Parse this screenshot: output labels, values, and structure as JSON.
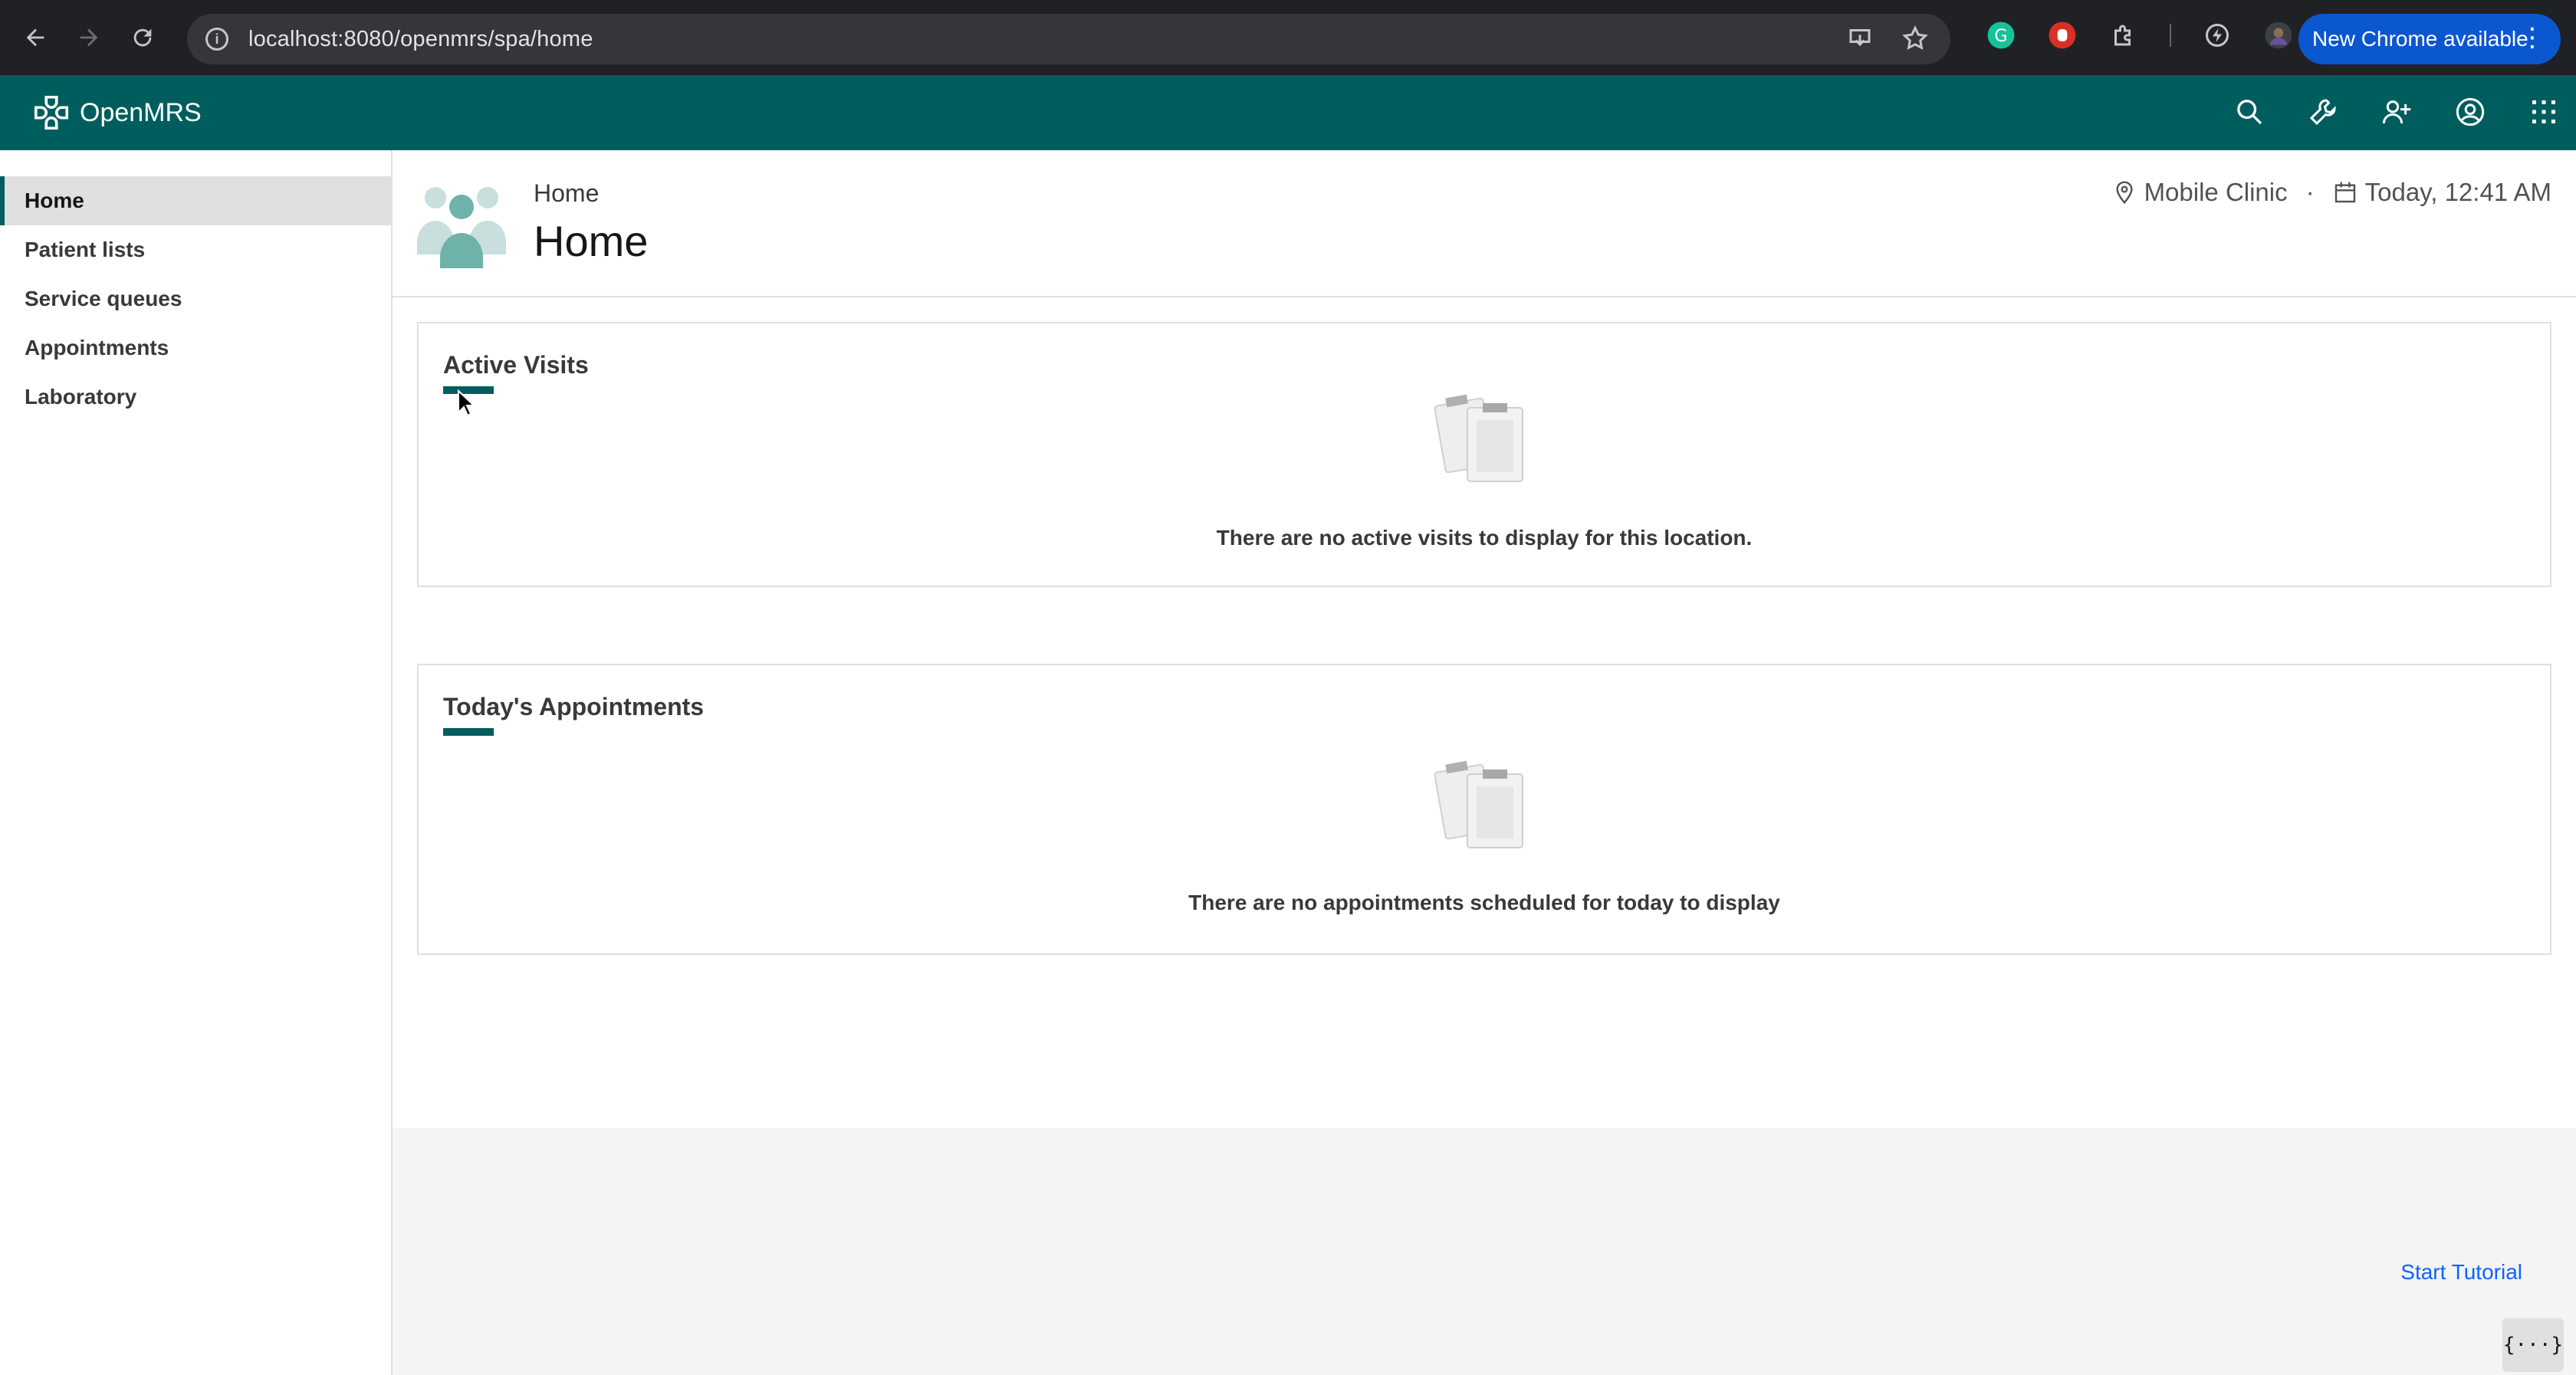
{
  "browser": {
    "url": "localhost:8080/openmrs/spa/home",
    "new_chrome_label": "New Chrome available"
  },
  "app": {
    "logo_text": "OpenMRS"
  },
  "sidebar": {
    "items": [
      {
        "label": "Home",
        "active": true
      },
      {
        "label": "Patient lists",
        "active": false
      },
      {
        "label": "Service queues",
        "active": false
      },
      {
        "label": "Appointments",
        "active": false
      },
      {
        "label": "Laboratory",
        "active": false
      }
    ]
  },
  "header": {
    "breadcrumb": "Home",
    "title": "Home",
    "location": "Mobile Clinic",
    "separator": "·",
    "datetime": "Today, 12:41 AM"
  },
  "active_visits": {
    "title": "Active Visits",
    "empty_message": "There are no active visits to display for this location."
  },
  "appointments": {
    "title": "Today's Appointments",
    "empty_message": "There are no appointments scheduled for today to display"
  },
  "footer": {
    "tutorial_label": "Start Tutorial",
    "devtools_label": "{···}"
  },
  "colors": {
    "brand": "#005d5d",
    "chrome_dark": "#202124",
    "link": "#0f62fe"
  }
}
